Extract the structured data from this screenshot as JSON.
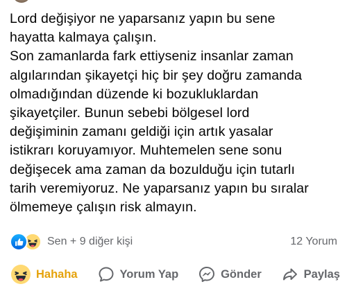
{
  "post": {
    "text": "Lord değişiyor ne yaparsanız yapın bu sene\nhayatta kalmaya çalışın.\nSon zamanlarda fark ettiyseniz insanlar zaman\nalgılarından şikayetçi hiç bir şey doğru zamanda\nolmadığından düzende ki bozukluklardan\nşikayetçiler. Bunun sebebi bölgesel lord\ndeğişiminin zamanı geldiği için artık yasalar\nistikrarı koruyamıyor. Muhtemelen sene sonu\ndeğişecek ama zaman da bozulduğu için tutarlı\ntarih veremiyoruz. Ne yaparsanız yapın bu sıralar\nölmemeye çalışın risk almayın."
  },
  "reactions": {
    "summary": "Sen + 9 diğer kişi",
    "comments": "12 Yorum",
    "icons": [
      "like-reaction-icon",
      "haha-reaction-icon"
    ]
  },
  "actions": {
    "haha": "Hahaha",
    "comment": "Yorum Yap",
    "send": "Gönder",
    "share": "Paylaş"
  },
  "colors": {
    "text": "#050505",
    "secondary": "#65676b",
    "like_blue": "#0866ff",
    "haha_yellow": "#e5a20a"
  }
}
